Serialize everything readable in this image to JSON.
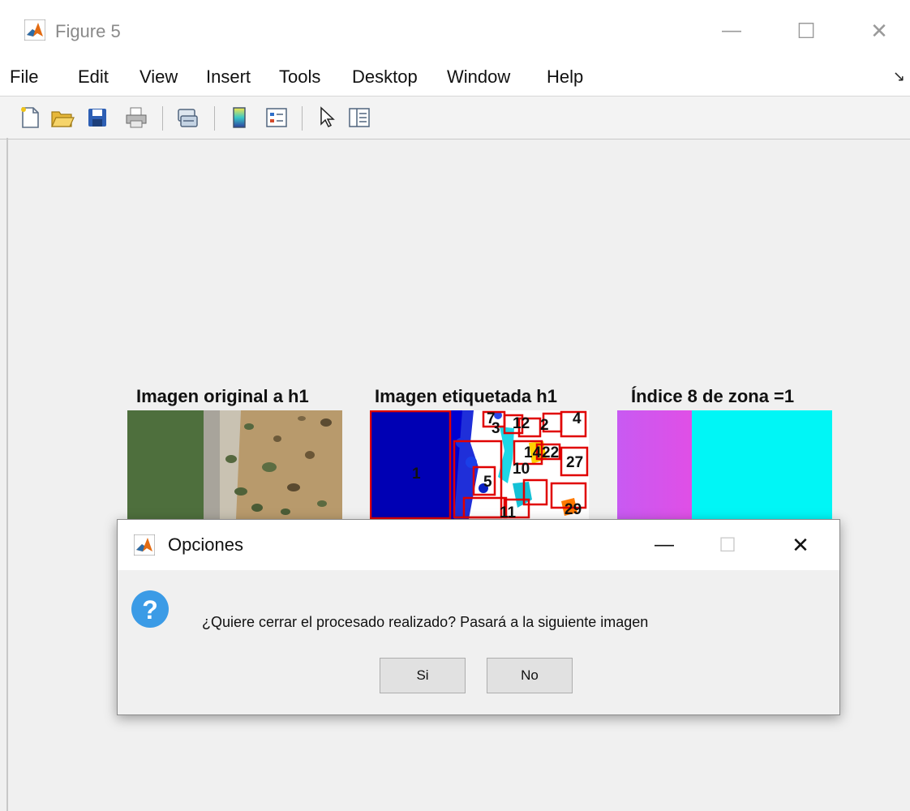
{
  "window": {
    "title": "Figure 5",
    "controls": {
      "minimize": "—",
      "maximize": "☐",
      "close": "✕"
    }
  },
  "menubar": {
    "items": [
      "File",
      "Edit",
      "View",
      "Insert",
      "Tools",
      "Desktop",
      "Window",
      "Help"
    ]
  },
  "toolbar": {
    "buttons": [
      "new-figure-icon",
      "open-file-icon",
      "save-icon",
      "print-icon",
      "link-plot-icon",
      "insert-colorbar-icon",
      "insert-legend-icon",
      "edit-plot-icon",
      "property-inspector-icon"
    ]
  },
  "axes": [
    {
      "title": "Imagen original a h1"
    },
    {
      "title": "Imagen etiquetada h1",
      "labels": [
        "1",
        "2",
        "3",
        "4",
        "5",
        "7",
        "10",
        "11",
        "12",
        "14",
        "22",
        "27",
        "29"
      ]
    },
    {
      "title": "Índice 8 de zona =1"
    }
  ],
  "dialog": {
    "title": "Opciones",
    "message": "¿Quiere cerrar el procesado realizado? Pasará a la siguiente imagen",
    "icon": "question-icon",
    "yes_label": "Si",
    "no_label": "No",
    "controls": {
      "minimize": "—",
      "maximize": "☐",
      "close": "✕"
    }
  },
  "colors": {
    "label_box": "#e00000",
    "region_blue": "#0000b4",
    "index_magenta": "#d455f0",
    "index_cyan": "#00f6f6",
    "question_blue": "#3b9be6"
  }
}
